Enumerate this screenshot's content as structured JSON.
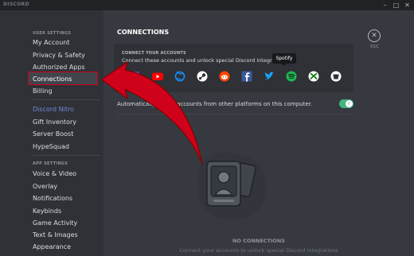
{
  "app": {
    "brand": "DISCORD",
    "minimize": "–",
    "maximize": "□",
    "close": "✕"
  },
  "sidebar": {
    "user_settings_header": "USER SETTINGS",
    "user_items": [
      "My Account",
      "Privacy & Safety",
      "Authorized Apps",
      "Connections",
      "Billing"
    ],
    "active_item": "Connections",
    "nitro_items": [
      "Discord Nitro",
      "Gift Inventory",
      "Server Boost",
      "HypeSquad"
    ],
    "app_settings_header": "APP SETTINGS",
    "app_items": [
      "Voice & Video",
      "Overlay",
      "Notifications",
      "Keybinds",
      "Game Activity",
      "Text & Images",
      "Appearance"
    ]
  },
  "main": {
    "title": "CONNECTIONS",
    "close_icon": "close-circle-icon",
    "esc_label": "ESC",
    "connect_header": "CONNECT YOUR ACCOUNTS",
    "connect_desc": "Connect these accounts and unlock special Discord integrations.",
    "services": [
      {
        "name": "Twitch",
        "icon": "twitch-icon",
        "color": "#6441a5"
      },
      {
        "name": "YouTube",
        "icon": "youtube-icon",
        "color": "#ff0000"
      },
      {
        "name": "Battle.net",
        "icon": "battlenet-icon",
        "color": "#148eff"
      },
      {
        "name": "Steam",
        "icon": "steam-icon",
        "color": "#ffffff"
      },
      {
        "name": "Reddit",
        "icon": "reddit-icon",
        "color": "#ff4500"
      },
      {
        "name": "Facebook",
        "icon": "facebook-icon",
        "color": "#3b5998"
      },
      {
        "name": "Twitter",
        "icon": "twitter-icon",
        "color": "#1da1f2"
      },
      {
        "name": "Spotify",
        "icon": "spotify-icon",
        "color": "#1db954"
      },
      {
        "name": "Xbox",
        "icon": "xbox-icon",
        "color": "#107c10"
      },
      {
        "name": "GitHub",
        "icon": "github-icon",
        "color": "#ffffff"
      }
    ],
    "tooltip": "Spotify",
    "auto_detect_label": "Automatically detect accounts from other platforms on this computer.",
    "auto_detect_enabled": true,
    "empty_title": "NO CONNECTIONS",
    "empty_subtitle": "Connect your accounts to unlock special Discord integrations"
  },
  "colors": {
    "accent": "#7289da",
    "highlight_box": "#d0021b",
    "arrow": "#d0021b",
    "toggle_on": "#43b581"
  }
}
